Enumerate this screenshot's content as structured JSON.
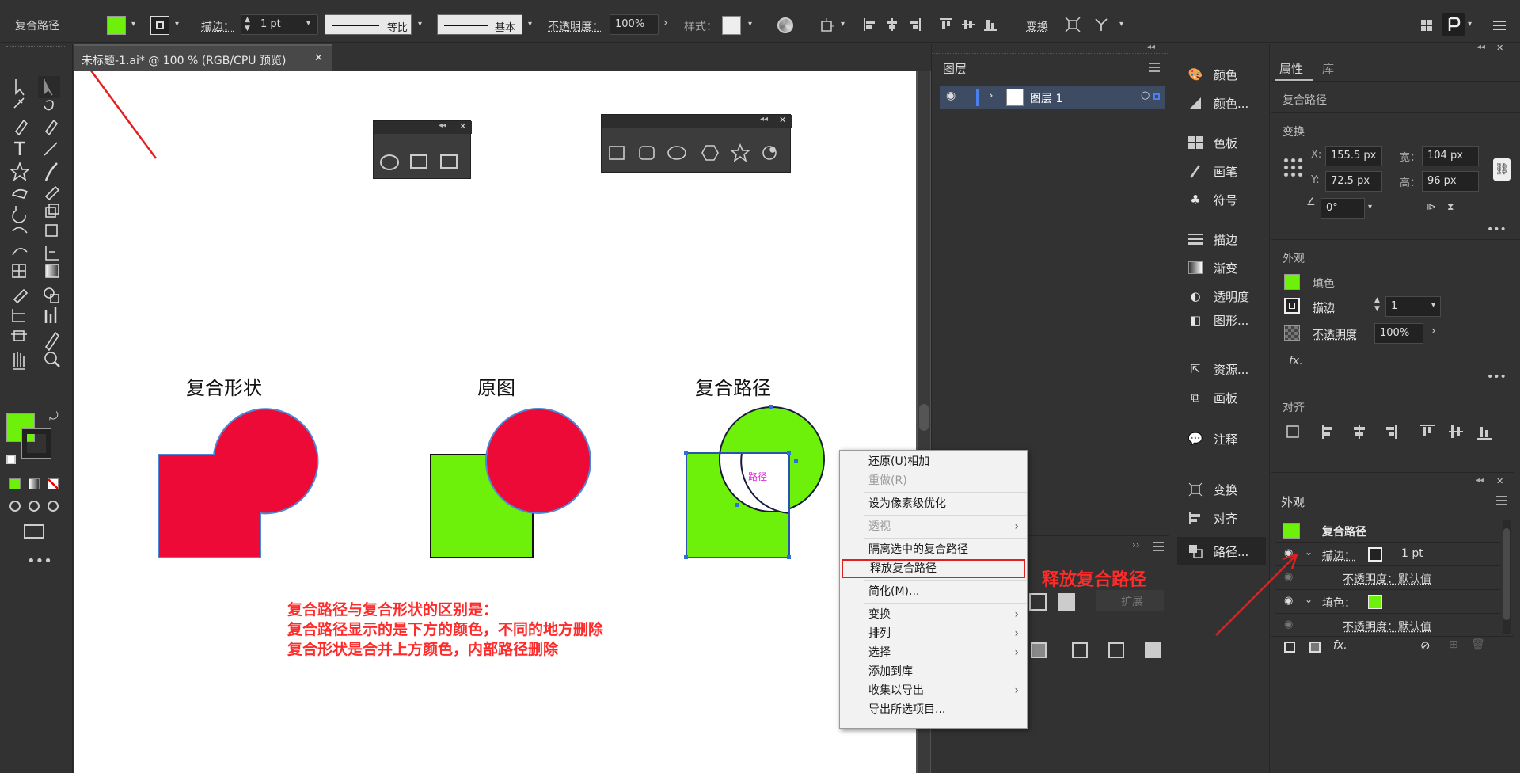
{
  "control_bar": {
    "object_type": "复合路径",
    "stroke_label": "描边：",
    "stroke_value": "1 pt",
    "profile_label": "等比",
    "brush_label": "基本",
    "opacity_label": "不透明度：",
    "opacity_value": "100%",
    "style_label": "样式：",
    "transform_label": "变换",
    "colors": {
      "fill": "#6df00a",
      "stroke": "#ffffff"
    }
  },
  "document": {
    "tab_title": "未标题-1.ai* @ 100 % (RGB/CPU 预览)",
    "close_glyph": "✕"
  },
  "canvas": {
    "label_compound_shape": "复合形状",
    "label_original": "原图",
    "label_compound_path": "复合路径",
    "path_hover_label": "路径",
    "note_lines": [
      "复合路径与复合形状的区别是：",
      "复合路径显示的是下方的颜色，不同的地方删除",
      "复合形状是合并上方颜色，内部路径删除"
    ],
    "release_annotation": "释放复合路径",
    "colors": {
      "red": "#ee0a37",
      "green": "#6df00a",
      "note": "#ff2b2b"
    }
  },
  "context_menu": {
    "items": [
      {
        "label": "还原(U)相加",
        "disabled": false,
        "arrow": false
      },
      {
        "label": "重做(R)",
        "disabled": true,
        "arrow": false
      },
      {
        "sep": true
      },
      {
        "label": "设为像素级优化",
        "disabled": false,
        "arrow": false
      },
      {
        "sep": true
      },
      {
        "label": "透视",
        "disabled": true,
        "arrow": true
      },
      {
        "sep": true
      },
      {
        "label": "隔离选中的复合路径",
        "disabled": false,
        "arrow": false
      },
      {
        "label": "释放复合路径",
        "disabled": false,
        "arrow": false,
        "highlight": true
      },
      {
        "sep": true
      },
      {
        "label": "简化(M)...",
        "disabled": false,
        "arrow": false
      },
      {
        "sep": true
      },
      {
        "label": "变换",
        "disabled": false,
        "arrow": true
      },
      {
        "label": "排列",
        "disabled": false,
        "arrow": true
      },
      {
        "label": "选择",
        "disabled": false,
        "arrow": true
      },
      {
        "label": "添加到库",
        "disabled": false,
        "arrow": false
      },
      {
        "label": "收集以导出",
        "disabled": false,
        "arrow": true
      },
      {
        "label": "导出所选项目...",
        "disabled": false,
        "arrow": false
      }
    ]
  },
  "layers_panel": {
    "tab": "图层",
    "layer_name": "图层 1"
  },
  "pathfinder_panel": {
    "expand_label": "扩展"
  },
  "dock_panels": {
    "items": [
      "颜色",
      "颜色...",
      "色板",
      "画笔",
      "符号",
      "描边",
      "渐变",
      "透明度",
      "图形...",
      "资源...",
      "画板",
      "注释",
      "变换",
      "对齐",
      "路径..."
    ]
  },
  "properties_panel": {
    "tabs": [
      "属性",
      "库"
    ],
    "object_type": "复合路径",
    "transform_title": "变换",
    "x_label": "X:",
    "x_value": "155.5 px",
    "y_label": "Y:",
    "y_value": "72.5 px",
    "w_label": "宽：",
    "w_value": "104 px",
    "h_label": "高：",
    "h_value": "96 px",
    "angle_value": "0°",
    "appearance_title": "外观",
    "fill_label": "填色",
    "stroke_label": "描边",
    "stroke_value": "1",
    "opacity_label": "不透明度",
    "opacity_value": "100%",
    "fx_label": "fx.",
    "align_title": "对齐"
  },
  "appearance_panel": {
    "title": "外观",
    "object_type": "复合路径",
    "stroke_label": "描边：",
    "stroke_value": "1 pt",
    "opacity_row": "不透明度：默认值",
    "fill_label": "填色：",
    "opacity_row2": "不透明度：默认值",
    "fx_label": "fx."
  }
}
